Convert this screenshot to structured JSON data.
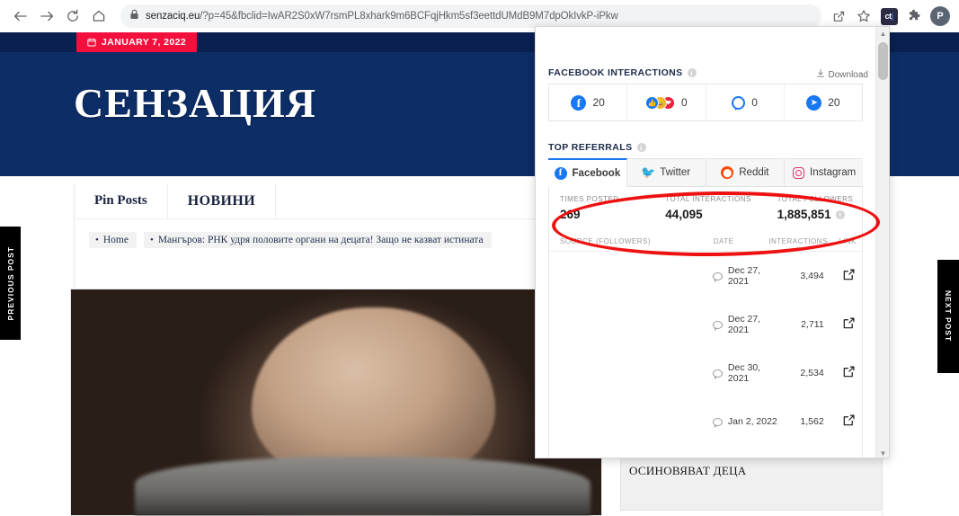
{
  "browser": {
    "back_icon": "back-arrow-icon",
    "forward_icon": "forward-arrow-icon",
    "reload_icon": "reload-icon",
    "home_icon": "home-icon",
    "lock_icon": "lock-icon",
    "url_host": "senzaciq.eu",
    "url_path": "/?p=45&fbclid=IwAR2S0xW7rsmPL8xhark9m6BCFqjHkm5sf3eettdUMdB9M7dpOkIvkP-iPkw",
    "share_icon": "share-icon",
    "bookmark_icon": "star-icon",
    "extension_ct_label": "ct",
    "extensions_icon": "puzzle-icon",
    "profile_initial": "P"
  },
  "site": {
    "date_badge": "JANUARY 7, 2022",
    "calendar_icon": "calendar-icon",
    "title": "СЕНЗАЦИЯ",
    "nav_tabs": [
      {
        "label": "Pin Posts"
      },
      {
        "label": "НОВИНИ"
      }
    ],
    "breadcrumbs": [
      {
        "label": "Home"
      },
      {
        "label": "Мангъров: РНК удря половите органи на децата! Защо не казват истината"
      }
    ],
    "prev_post": "PREVIOUS POST",
    "next_post": "NEXT POST",
    "bottom_headline": "ОСИНОВЯВАТ ДЕЦА"
  },
  "crowdtangle": {
    "facebook_interactions": {
      "title": "FACEBOOK INTERACTIONS",
      "info_glyph": "i",
      "download_label": "Download",
      "download_icon": "download-icon",
      "stats": [
        {
          "icon": "facebook-icon",
          "value": "20"
        },
        {
          "icon": "reactions-icon",
          "value": "0"
        },
        {
          "icon": "comment-icon",
          "value": "0"
        },
        {
          "icon": "share-icon",
          "value": "20"
        }
      ]
    },
    "top_referrals": {
      "title": "TOP REFERRALS",
      "info_glyph": "i",
      "tabs": [
        {
          "label": "Facebook",
          "icon": "facebook-icon",
          "active": true
        },
        {
          "label": "Twitter",
          "icon": "twitter-icon",
          "active": false
        },
        {
          "label": "Reddit",
          "icon": "reddit-icon",
          "active": false
        },
        {
          "label": "Instagram",
          "icon": "instagram-icon",
          "active": false
        }
      ],
      "summary": [
        {
          "label": "TIMES POSTED",
          "value": "269"
        },
        {
          "label": "TOTAL INTERACTIONS",
          "value": "44,095"
        },
        {
          "label": "TOTAL FOLLOWERS",
          "value": "1,885,851"
        }
      ],
      "table_headers": {
        "source": "SOURCE (FOLLOWERS)",
        "date": "DATE",
        "interactions": "INTERACTIONS",
        "link": "LINK"
      },
      "rows": [
        {
          "source": "",
          "icon": "comment-bubble-icon",
          "date": "Dec 27, 2021",
          "interactions": "3,494",
          "link_icon": "external-link-icon"
        },
        {
          "source": "",
          "icon": "comment-bubble-icon",
          "date": "Dec 27, 2021",
          "interactions": "2,711",
          "link_icon": "external-link-icon"
        },
        {
          "source": "",
          "icon": "comment-bubble-icon",
          "date": "Dec 30, 2021",
          "interactions": "2,534",
          "link_icon": "external-link-icon"
        },
        {
          "source": "",
          "icon": "comment-bubble-icon",
          "date": "Jan 2, 2022",
          "interactions": "1,562",
          "link_icon": "external-link-icon"
        }
      ]
    },
    "scrollbar": {
      "up_glyph": "▲",
      "down_glyph": "▼"
    }
  },
  "annotation": {
    "shape": "red-ellipse-highlight",
    "color": "#ee1111"
  }
}
